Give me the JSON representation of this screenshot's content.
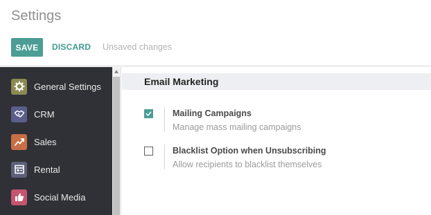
{
  "header": {
    "title": "Settings",
    "save_label": "SAVE",
    "discard_label": "DISCARD",
    "status": "Unsaved changes"
  },
  "sidebar": {
    "items": [
      {
        "label": "General Settings",
        "icon": "gear-icon",
        "color": "#8a8a52"
      },
      {
        "label": "CRM",
        "icon": "handshake-icon",
        "color": "#5b5e8c"
      },
      {
        "label": "Sales",
        "icon": "chart-icon",
        "color": "#c86f45"
      },
      {
        "label": "Rental",
        "icon": "register-icon",
        "color": "#5c6078"
      },
      {
        "label": "Social Media",
        "icon": "thumbs-up-icon",
        "color": "#c4546f"
      }
    ]
  },
  "main": {
    "section_title": "Email Marketing",
    "settings": [
      {
        "title": "Mailing Campaigns",
        "description": "Manage mass mailing campaigns",
        "checked": true
      },
      {
        "title": "Blacklist Option when Unsubscribing",
        "description": "Allow recipients to blacklist themselves",
        "checked": false
      }
    ]
  },
  "colors": {
    "accent": "#4c9d95",
    "sidebar_bg": "#2f3136",
    "section_bg": "#eeeff2"
  }
}
